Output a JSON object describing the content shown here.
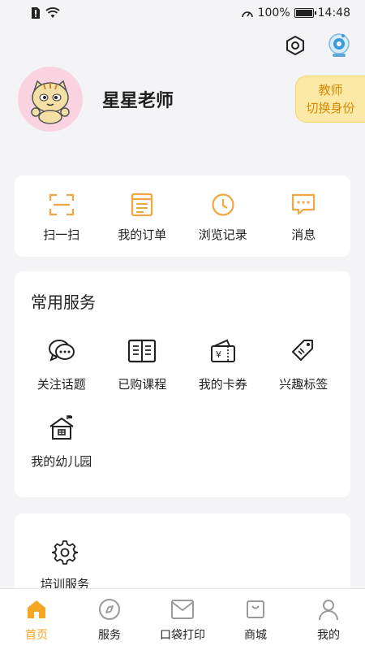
{
  "status_bar": {
    "battery": "100%",
    "time": "14:48",
    "battery_level": 1.0
  },
  "top_actions": {
    "settings_icon": "settings-hexagon-icon",
    "camera_icon": "webcam-icon"
  },
  "profile": {
    "name": "星星老师",
    "avatar_icon": "cartoon-cat-avatar"
  },
  "role_switch": {
    "line1": "教师",
    "line2": "切换身份"
  },
  "quick_actions": [
    {
      "label": "扫一扫",
      "icon": "scan-icon"
    },
    {
      "label": "我的订单",
      "icon": "order-icon"
    },
    {
      "label": "浏览记录",
      "icon": "clock-icon"
    },
    {
      "label": "消息",
      "icon": "message-icon"
    }
  ],
  "services": {
    "title": "常用服务",
    "items": [
      {
        "label": "关注话题",
        "icon": "chat-bubbles-icon"
      },
      {
        "label": "已购课程",
        "icon": "book-icon"
      },
      {
        "label": "我的卡券",
        "icon": "coupon-icon"
      },
      {
        "label": "兴趣标签",
        "icon": "tag-icon"
      },
      {
        "label": "我的幼儿园",
        "icon": "kindergarten-icon"
      }
    ]
  },
  "training": {
    "label": "培训服务",
    "icon": "gear-icon"
  },
  "tabs": [
    {
      "label": "首页",
      "icon": "home-icon",
      "active": true
    },
    {
      "label": "服务",
      "icon": "compass-icon",
      "active": false
    },
    {
      "label": "口袋打印",
      "icon": "envelope-icon",
      "active": false
    },
    {
      "label": "商城",
      "icon": "shop-bag-icon",
      "active": false
    },
    {
      "label": "我的",
      "icon": "user-icon",
      "active": false
    }
  ],
  "colors": {
    "accent": "#f5a623",
    "quick_icon": "#f0a641",
    "role_bg": "#fde9a6",
    "role_text": "#d48a00"
  }
}
